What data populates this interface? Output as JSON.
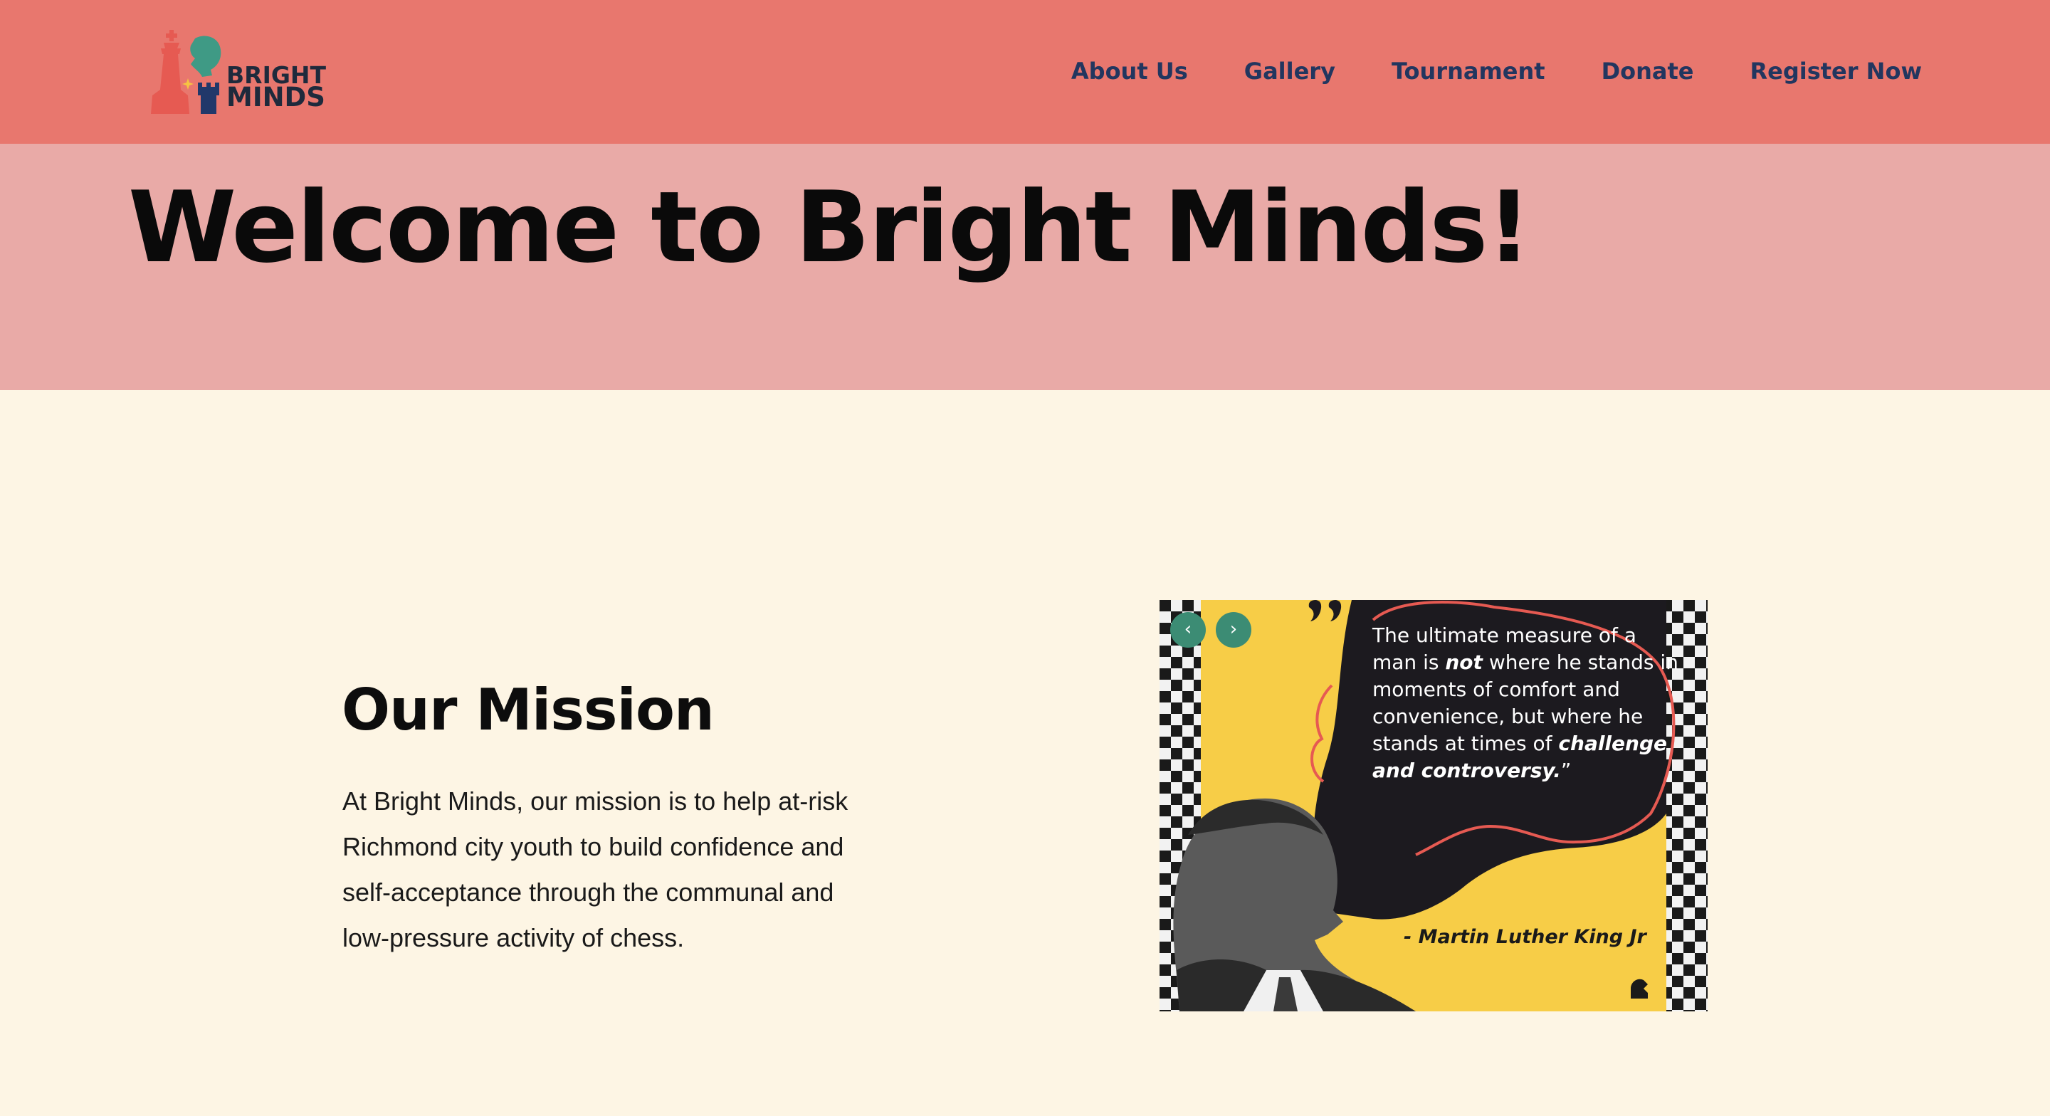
{
  "brand": {
    "line1": "BRIGHT",
    "line2": "MINDS",
    "colors": {
      "header": "#e8776e",
      "hero": "#e9aaa7",
      "page": "#fdf5e4",
      "nav_text": "#22365f",
      "slider_btn": "#3c8c74",
      "quote_bg": "#f7cd47"
    }
  },
  "nav": {
    "items": [
      {
        "label": "About Us"
      },
      {
        "label": "Gallery"
      },
      {
        "label": "Tournament"
      },
      {
        "label": "Donate"
      },
      {
        "label": "Register Now"
      }
    ]
  },
  "hero": {
    "title": "Welcome to Bright Minds!"
  },
  "mission": {
    "title": "Our Mission",
    "text": "At Bright Minds, our mission is to help at-risk Richmond city youth to build confidence and self-acceptance through the communal and low-pressure activity of chess."
  },
  "slider": {
    "prev_icon": "‹",
    "next_icon": "›",
    "quote": {
      "part1": "The ultimate measure of a man is ",
      "emph1": "not",
      "part2": " where he stands in moments of comfort and convenience, but where he stands at times of ",
      "emph2": "challenge and controversy.",
      "close": "”",
      "author": "- Martin Luther King Jr"
    }
  }
}
